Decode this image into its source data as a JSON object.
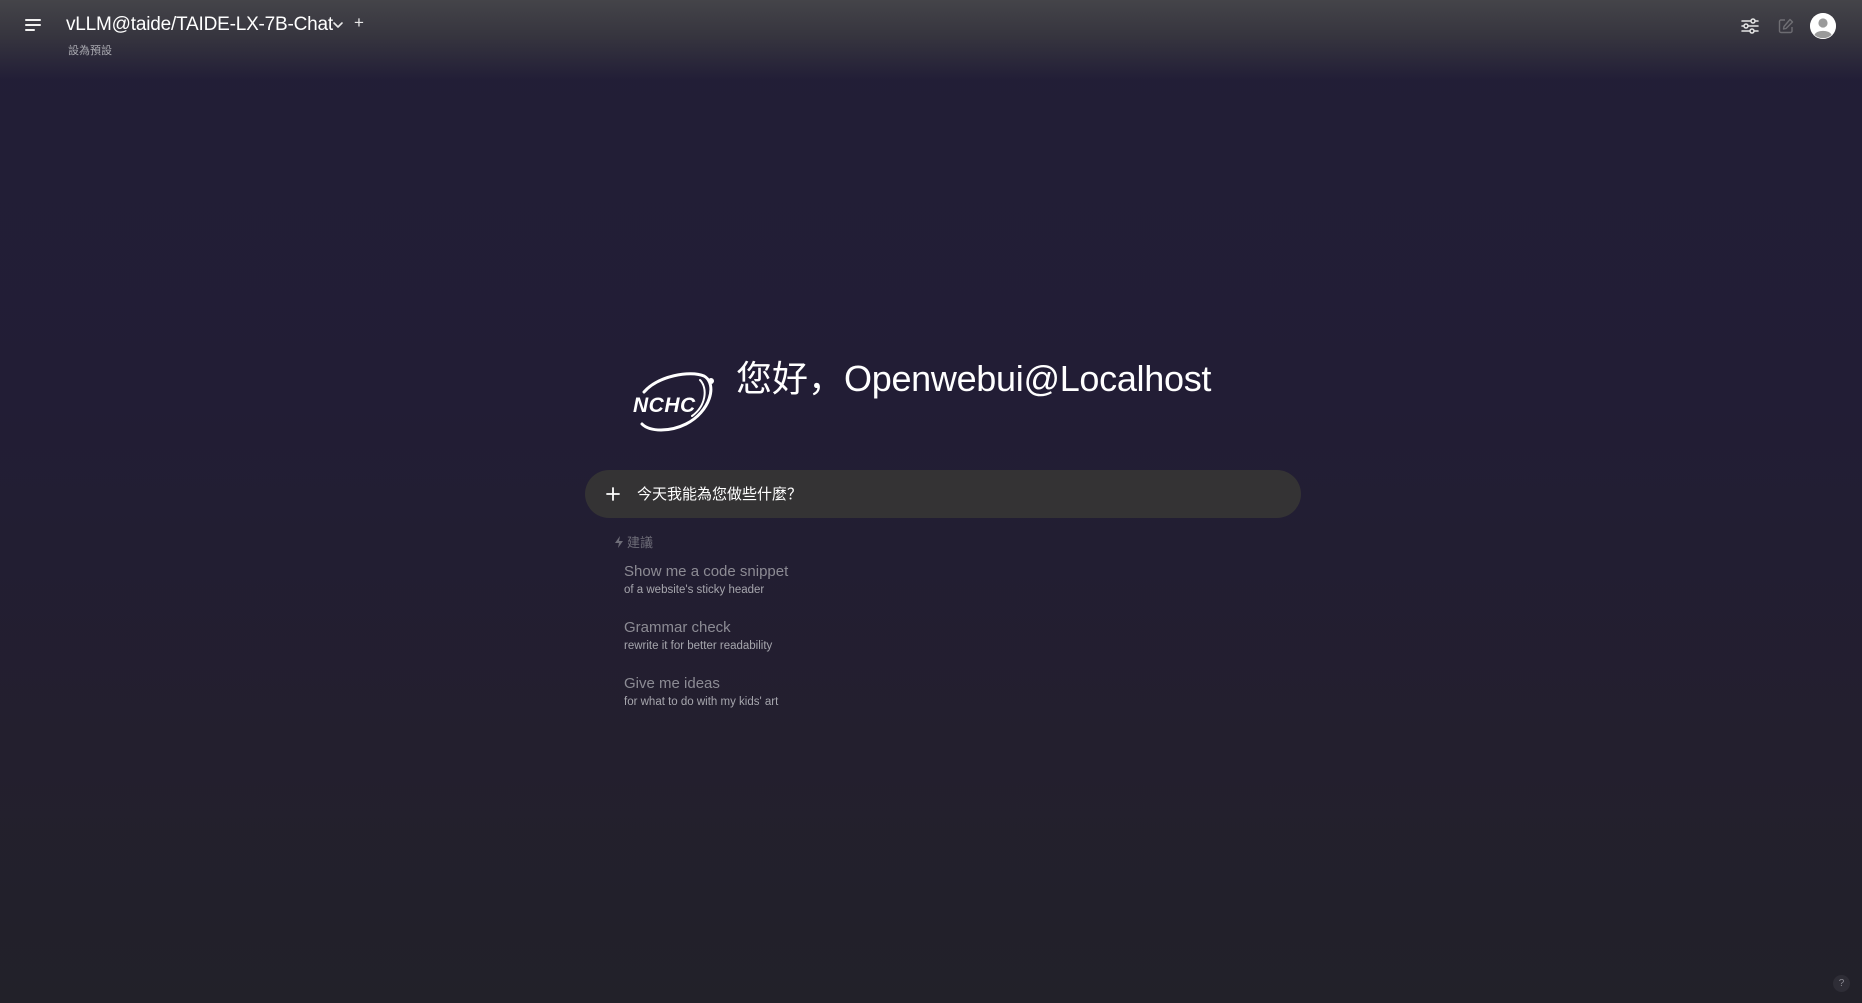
{
  "header": {
    "model_name": "vLLM@taide/TAIDE-LX-7B-Chat",
    "add_model_symbol": "+",
    "set_default_label": "設為預設",
    "icons": [
      "menu-icon",
      "chevron-down-icon",
      "controls-sliders-icon",
      "new-chat-icon",
      "user-avatar-icon"
    ]
  },
  "welcome": {
    "logo_text": "NCHC",
    "greeting_prefix": "您好，",
    "greeting_name": "Openwebui@Localhost"
  },
  "chat_input": {
    "placeholder": "今天我能為您做些什麼？",
    "attach_icon": "plus-icon"
  },
  "suggestions": {
    "label": "建議",
    "label_icon": "bolt-icon",
    "items": [
      {
        "title": "Show me a code snippet",
        "subtitle": "of a website's sticky header"
      },
      {
        "title": "Grammar check",
        "subtitle": "rewrite it for better readability"
      },
      {
        "title": "Give me ideas",
        "subtitle": "for what to do with my kids' art"
      }
    ]
  },
  "help": {
    "label": "?"
  },
  "colors": {
    "background": "#221e37",
    "input_background": "#343334",
    "suggestion_title": "#8c8b94"
  }
}
